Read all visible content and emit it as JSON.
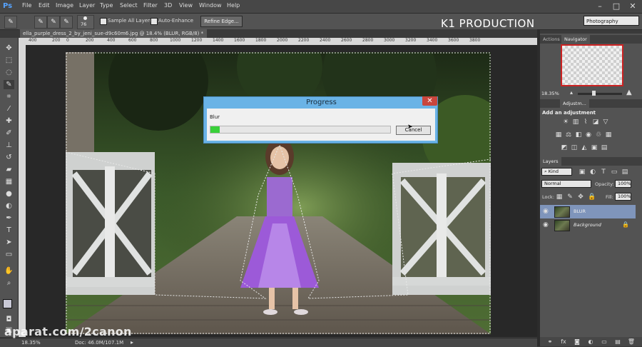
{
  "app": {
    "logo": "Ps",
    "menu": [
      "File",
      "Edit",
      "Image",
      "Layer",
      "Type",
      "Select",
      "Filter",
      "3D",
      "View",
      "Window",
      "Help"
    ],
    "win_buttons": [
      "–",
      "□",
      "✕"
    ]
  },
  "options": {
    "brush_size": "76",
    "sample_all_layers": "Sample All Layers",
    "auto_enhance": "Auto-Enhance",
    "refine_edge": "Refine Edge...",
    "workspace": "Photography"
  },
  "watermark_top": "K1 PRODUCTION",
  "document": {
    "tab": "ella_purple_dress_2_by_jeni_sue-d9c60m6.jpg @ 18.4% (BLUR, RGB/8) *",
    "tab_close": "✕"
  },
  "ruler": {
    "ticks": [
      "400",
      "200",
      "0",
      "200",
      "400",
      "600",
      "800",
      "1000",
      "1200",
      "1400",
      "1600",
      "1800",
      "2000",
      "2200",
      "2400",
      "2600",
      "2800",
      "3000",
      "3200",
      "3400",
      "3600",
      "3800"
    ]
  },
  "status": {
    "zoom": "18.35%",
    "doc": "Doc: 46.0M/107.1M"
  },
  "dialog": {
    "title": "Progress",
    "close": "✕",
    "label": "Blur",
    "progress": 0.05,
    "cancel": "Cancel"
  },
  "panels": {
    "tabs_top": [
      "Actions",
      "Navigator"
    ],
    "nav_zoom": "18.35%",
    "tabs_mid": [
      "Adjustm..."
    ],
    "adj_header": "Add an adjustment",
    "layers_tab": "Layers",
    "kind": "Kind",
    "blend": "Normal",
    "opacity_label": "Opacity:",
    "opacity": "100%",
    "lock_label": "Lock:",
    "fill_label": "Fill:",
    "fill": "100%",
    "layers": [
      {
        "name": "BLUR",
        "selected": true
      },
      {
        "name": "Background",
        "selected": false
      }
    ]
  },
  "watermark_bottom": "aparat.com/2canon",
  "colors": {
    "selection": "#7f95bb",
    "progress": "#39d039",
    "accent_blue": "#6ab3e6"
  }
}
